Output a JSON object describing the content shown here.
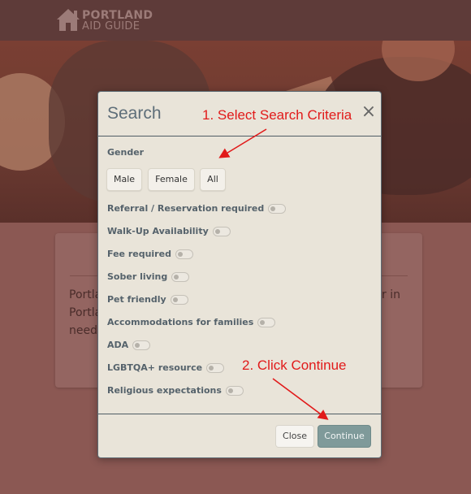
{
  "brand": {
    "line1": "PORTLAND",
    "line2": "AID GUIDE",
    "icon": "house-icon"
  },
  "background_card": {
    "line1": "Portla",
    "line2": "Portla",
    "line3": "needs",
    "line1_right": "lter in"
  },
  "modal": {
    "title": "Search",
    "close_icon": "close-icon",
    "gender_label": "Gender",
    "gender_options": [
      "Male",
      "Female",
      "All"
    ],
    "filters": [
      "Referral / Reservation required",
      "Walk-Up Availability",
      "Fee required",
      "Sober living",
      "Pet friendly",
      "Accommodations for families",
      "ADA",
      "LGBTQA+ resource",
      "Religious expectations"
    ],
    "filter_states": [
      false,
      false,
      false,
      false,
      false,
      false,
      false,
      false,
      false
    ],
    "close_button": "Close",
    "continue_button": "Continue"
  },
  "annotations": {
    "step1": "1. Select Search Criteria",
    "step2": "2. Click Continue",
    "color": "#e11a1a"
  },
  "colors": {
    "overlay": "#8a5a56",
    "modal_bg": "#e9e4d9",
    "continue_bg": "#7f9a9a",
    "title_color": "#5e6e79"
  }
}
